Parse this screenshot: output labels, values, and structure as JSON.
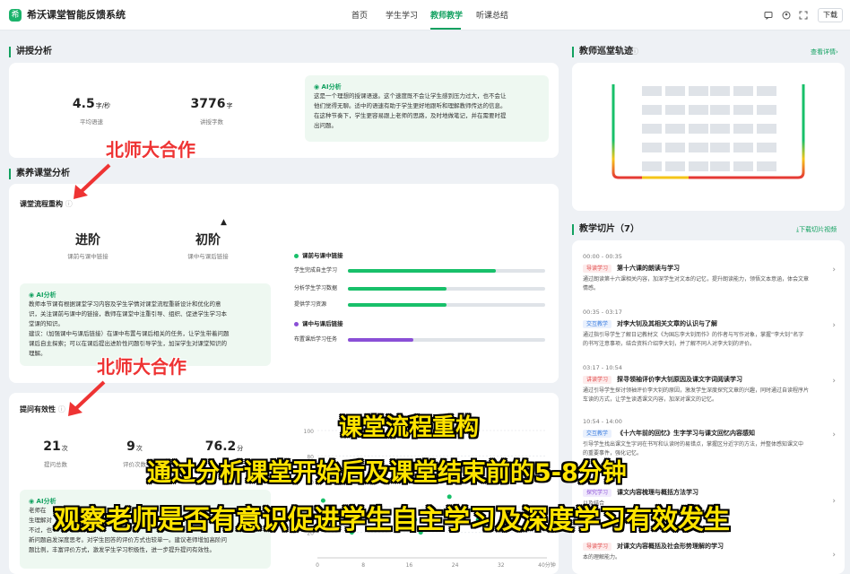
{
  "header": {
    "logo_text": "希",
    "app_title": "希沃课堂智能反馈系统",
    "nav": [
      "首页",
      "学生学习",
      "教师教学",
      "听课总结"
    ],
    "active_nav": "教师教学",
    "download": "下载"
  },
  "lecture": {
    "section": "讲授分析",
    "speed": {
      "value": "4.5",
      "unit": "字/秒",
      "label": "平均语速"
    },
    "words": {
      "value": "3776",
      "unit": "字",
      "label": "讲授字数"
    },
    "ai_head": "AI分析",
    "ai_lines": [
      "这是一个理想的授课语速。这个速度既不会让学生感到压力过大，也不会让",
      "他们觉得无聊。适中的语速有助于学生更好地跟听和理解教师传达的信息。",
      "在这种节奏下，学生更容易跟上老师的思路，及时地做笔记，并在需要时提",
      "出问题。"
    ]
  },
  "literacy": {
    "section": "素养课堂分析",
    "flow_title": "课堂流程重构",
    "info_icon": "ⓘ",
    "stat1": {
      "value": "进阶",
      "label": "课前与课中链接"
    },
    "stat2": {
      "value": "初阶",
      "label": "课中与课后链接"
    },
    "legend1": "课前与课中链接",
    "legend2": "课中与课后链接",
    "bars": [
      {
        "label": "学生完成自主学习",
        "value": 0.75
      },
      {
        "label": "分析学生学习数据",
        "value": 0.5
      },
      {
        "label": "提供学习资源",
        "value": 0.5
      }
    ],
    "bar4": {
      "label": "布置课后学习任务",
      "value": 0.33
    },
    "legend_color1": "#18c06a",
    "legend_color2": "#8a4fd6",
    "ai_head": "AI分析",
    "ai_lines": [
      "教师本节课有根据课堂学习内容及学生学情对课堂流程重新设计和优化的意",
      "识，关注课前与课中的链接，教师在课堂中注重引导、组织、促进学生学习本",
      "堂课的知识。",
      "建议：(加强课中与课后链接）在课中布置与课后相关的任务，让学生带着问题",
      "课后自主探索；可以在课后提出进阶性问题引导学生，加深学生对课堂知识的",
      "理解。"
    ]
  },
  "question": {
    "title": "提问有效性",
    "stats": [
      {
        "value": "21",
        "unit": "次",
        "label": "提问总数"
      },
      {
        "value": "9",
        "unit": "次",
        "label": "评价次数"
      },
      {
        "value": "76.2",
        "unit": "分",
        "label": ""
      }
    ],
    "ai_head": "AI分析",
    "ai_lines": [
      "老师在",
      "生理解对",
      "不过，也",
      "新问题启发深度思考。对学生回答的评价方式也较单一。建议老师增加高阶问",
      "题比例，丰富评价方式，激发学生学习积极性，进一步提升提问有效性。"
    ]
  },
  "chart_data": {
    "type": "scatter",
    "x_ticks": [
      "0",
      "8",
      "16",
      "24",
      "32",
      "40分钟"
    ],
    "y_ticks": [
      "20",
      "40",
      "60",
      "80",
      "100"
    ],
    "xlim": [
      0,
      40
    ],
    "ylim": [
      0,
      100
    ],
    "points": [
      [
        1,
        75
      ],
      [
        1,
        45
      ],
      [
        6,
        20
      ],
      [
        10,
        22
      ],
      [
        17,
        30
      ],
      [
        18,
        20
      ],
      [
        23,
        48
      ],
      [
        25,
        28
      ],
      [
        27,
        38
      ],
      [
        28,
        30
      ],
      [
        29,
        26
      ],
      [
        35,
        33
      ]
    ]
  },
  "track": {
    "section": "教师巡堂轨迹",
    "more": "查看详情",
    "more_icon": "›"
  },
  "clips": {
    "section": "教学切片（7）",
    "download": "下载切片视频",
    "download_icon": "⤓",
    "chevron": "›",
    "items": [
      {
        "time": "00:00 - 00:35",
        "tag": "导读学习",
        "title": "第十六课的朗读与学习",
        "desc": [
          "通过朗读第十六课相关内容，加深学生对文本的记忆，提升朗读能力，领悟文本意涵，体会文章",
          "情感。"
        ]
      },
      {
        "time": "00:35 - 03:17",
        "tag": "交互教学",
        "title": "对李大钊及其相关文章的认识与了解",
        "desc": [
          "通过指引导学生了解日记教材文《为国忘李大钊而作》的作者与写作对象，掌握“李大钊”名字",
          "的书写注意事项，结合资料介绍李大钊，并了解不同人对李大钊的评价。"
        ]
      },
      {
        "time": "03:17 - 10:54",
        "tag": "讲读学习",
        "title": "探寻领袖评价李大钊原因及课文字词阅读学习",
        "desc": [
          "通过引导学生探讨领袖评价李大钊的原因，激发学生深度探究文章的兴趣，同时通过自读程序片",
          "车读的方式，让学生读透课文内容，加深对课文的记忆。"
        ]
      },
      {
        "time": "10:54 - 14:00",
        "tag": "交互教学",
        "title": "《十六年前的回忆》生字学习与课文回忆内容感知",
        "desc": [
          "引导学生找出课文生字词在书写和认读时的易错点，掌握区分近字的方法，并整体感知课文中",
          "的重要事件，强化记忆。"
        ]
      },
      {
        "time": "",
        "tag": "探究学习",
        "title": "课文内容梳理与概括方法学习",
        "desc": [
          "",
          "以及结合"
        ]
      },
      {
        "time": "",
        "tag": "导读学习",
        "title": "对课文内容概括及社会形势理解的学习",
        "desc": [
          "",
          "本的理解能力。"
        ]
      }
    ]
  },
  "annotations": {
    "label1": "北师大合作",
    "label2": "北师大合作"
  },
  "captions": {
    "line1": "课堂流程重构",
    "line2": "通过分析课堂开始后及课堂结束前的5-8分钟",
    "line3": "观察老师是否有意识促进学生自主学习及深度学习有效发生"
  }
}
